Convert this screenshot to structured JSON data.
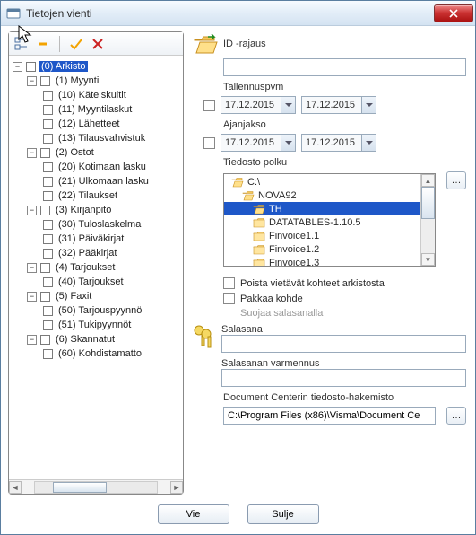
{
  "window": {
    "title": "Tietojen vienti"
  },
  "toolbar": {},
  "tree": {
    "root": "(0) Arkisto",
    "n1": {
      "label": "(1) Myynti",
      "c": [
        "(10) Käteiskuitit",
        "(11) Myyntilaskut",
        "(12) Lähetteet",
        "(13) Tilausvahvistuk"
      ]
    },
    "n2": {
      "label": "(2) Ostot",
      "c": [
        "(20) Kotimaan lasku",
        "(21) Ulkomaan lasku",
        "(22) Tilaukset"
      ]
    },
    "n3": {
      "label": "(3) Kirjanpito",
      "c": [
        "(30) Tuloslaskelma",
        "(31) Päiväkirjat",
        "(32) Pääkirjat"
      ]
    },
    "n4": {
      "label": "(4) Tarjoukset",
      "c": [
        "(40) Tarjoukset"
      ]
    },
    "n5": {
      "label": "(5) Faxit",
      "c": [
        "(50) Tarjouspyynnö",
        "(51) Tukipyynnöt"
      ]
    },
    "n6": {
      "label": "(6) Skannatut",
      "c": [
        "(60) Kohdistamatto"
      ]
    }
  },
  "right": {
    "idrajaus_label": "ID -rajaus",
    "tallennuspvm_label": "Tallennuspvm",
    "ajanjakso_label": "Ajanjakso",
    "date1a": "17.12.2015",
    "date1b": "17.12.2015",
    "date2a": "17.12.2015",
    "date2b": "17.12.2015",
    "tiedosto_polku_label": "Tiedosto polku",
    "files": [
      "C:\\",
      "NOVA92",
      "TH",
      "DATATABLES-1.10.5",
      "Finvoice1.1",
      "Finvoice1.2",
      "Finvoice1.3"
    ],
    "files_selected_index": 2,
    "poista_label": "Poista vietävät kohteet arkistosta",
    "pakkaa_label": "Pakkaa  kohde",
    "suojaa_label": "Suojaa salasanalla",
    "salasana_label": "Salasana",
    "varmennus_label": "Salasanan varmennus",
    "dc_label": "Document Centerin tiedosto-hakemisto",
    "dc_path": "C:\\Program Files (x86)\\Visma\\Document Ce"
  },
  "buttons": {
    "export": "Vie",
    "close": "Sulje"
  }
}
